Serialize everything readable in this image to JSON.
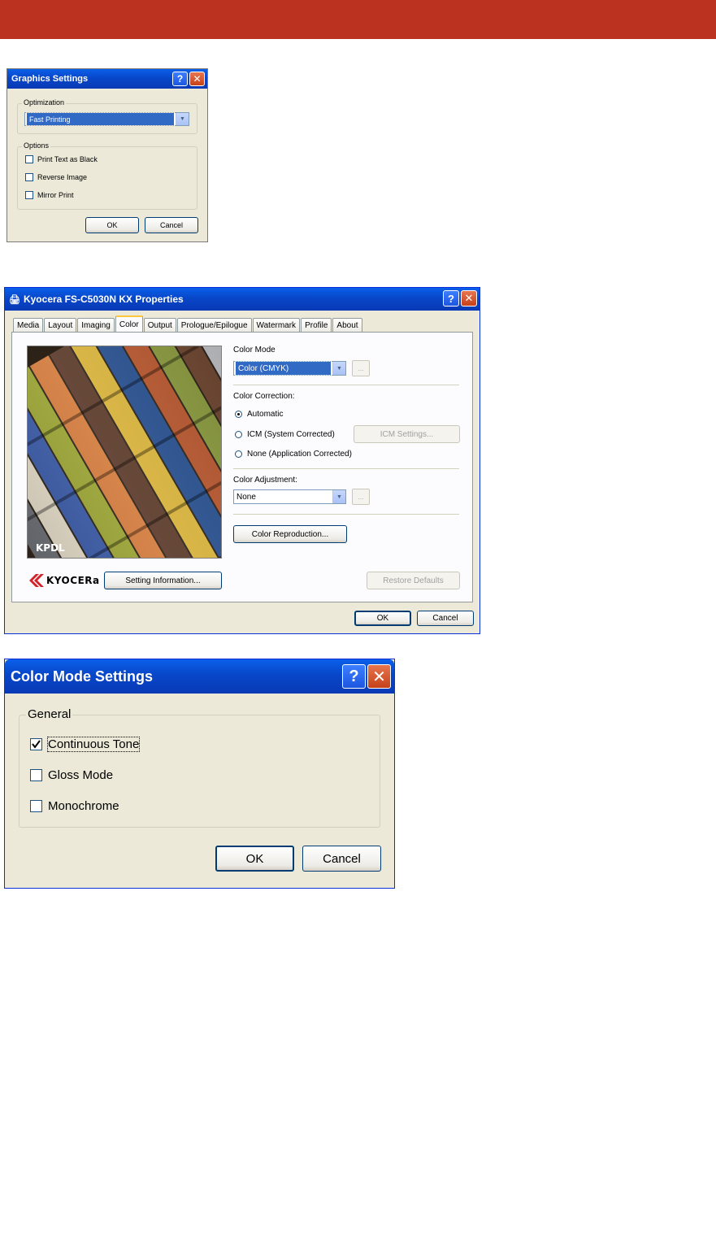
{
  "graphics_settings": {
    "title": "Graphics Settings",
    "optimization_label": "Optimization",
    "optimization_value": "Fast Printing",
    "options_label": "Options",
    "options": [
      {
        "label": "Print Text as Black",
        "checked": false
      },
      {
        "label": "Reverse Image",
        "checked": false
      },
      {
        "label": "Mirror Print",
        "checked": false
      }
    ],
    "ok_label": "OK",
    "cancel_label": "Cancel"
  },
  "properties": {
    "title": "Kyocera FS-C5030N KX Properties",
    "tabs": [
      "Media",
      "Layout",
      "Imaging",
      "Color",
      "Output",
      "Prologue/Epilogue",
      "Watermark",
      "Profile",
      "About"
    ],
    "active_tab": "Color",
    "preview_caption": "KPDL",
    "color_mode_label": "Color Mode",
    "color_mode_value": "Color (CMYK)",
    "ellipsis": "...",
    "color_correction_label": "Color Correction:",
    "radio_automatic": "Automatic",
    "radio_icm": "ICM (System Corrected)",
    "radio_none": "None (Application Corrected)",
    "icm_settings_label": "ICM Settings...",
    "color_adjustment_label": "Color Adjustment:",
    "color_adjustment_value": "None",
    "color_reproduction_label": "Color Reproduction...",
    "logo_text": "KYOCERa",
    "setting_information_label": "Setting Information...",
    "restore_defaults_label": "Restore Defaults",
    "ok_label": "OK",
    "cancel_label": "Cancel"
  },
  "color_mode_settings": {
    "title": "Color Mode Settings",
    "general_label": "General",
    "options": [
      {
        "label": "Continuous Tone",
        "checked": true
      },
      {
        "label": "Gloss Mode",
        "checked": false
      },
      {
        "label": "Monochrome",
        "checked": false
      }
    ],
    "ok_label": "OK",
    "cancel_label": "Cancel"
  },
  "colors": {
    "banner": "#bb3220",
    "xp_blue": "#0847c9",
    "dialog_bg": "#ece9d8"
  }
}
